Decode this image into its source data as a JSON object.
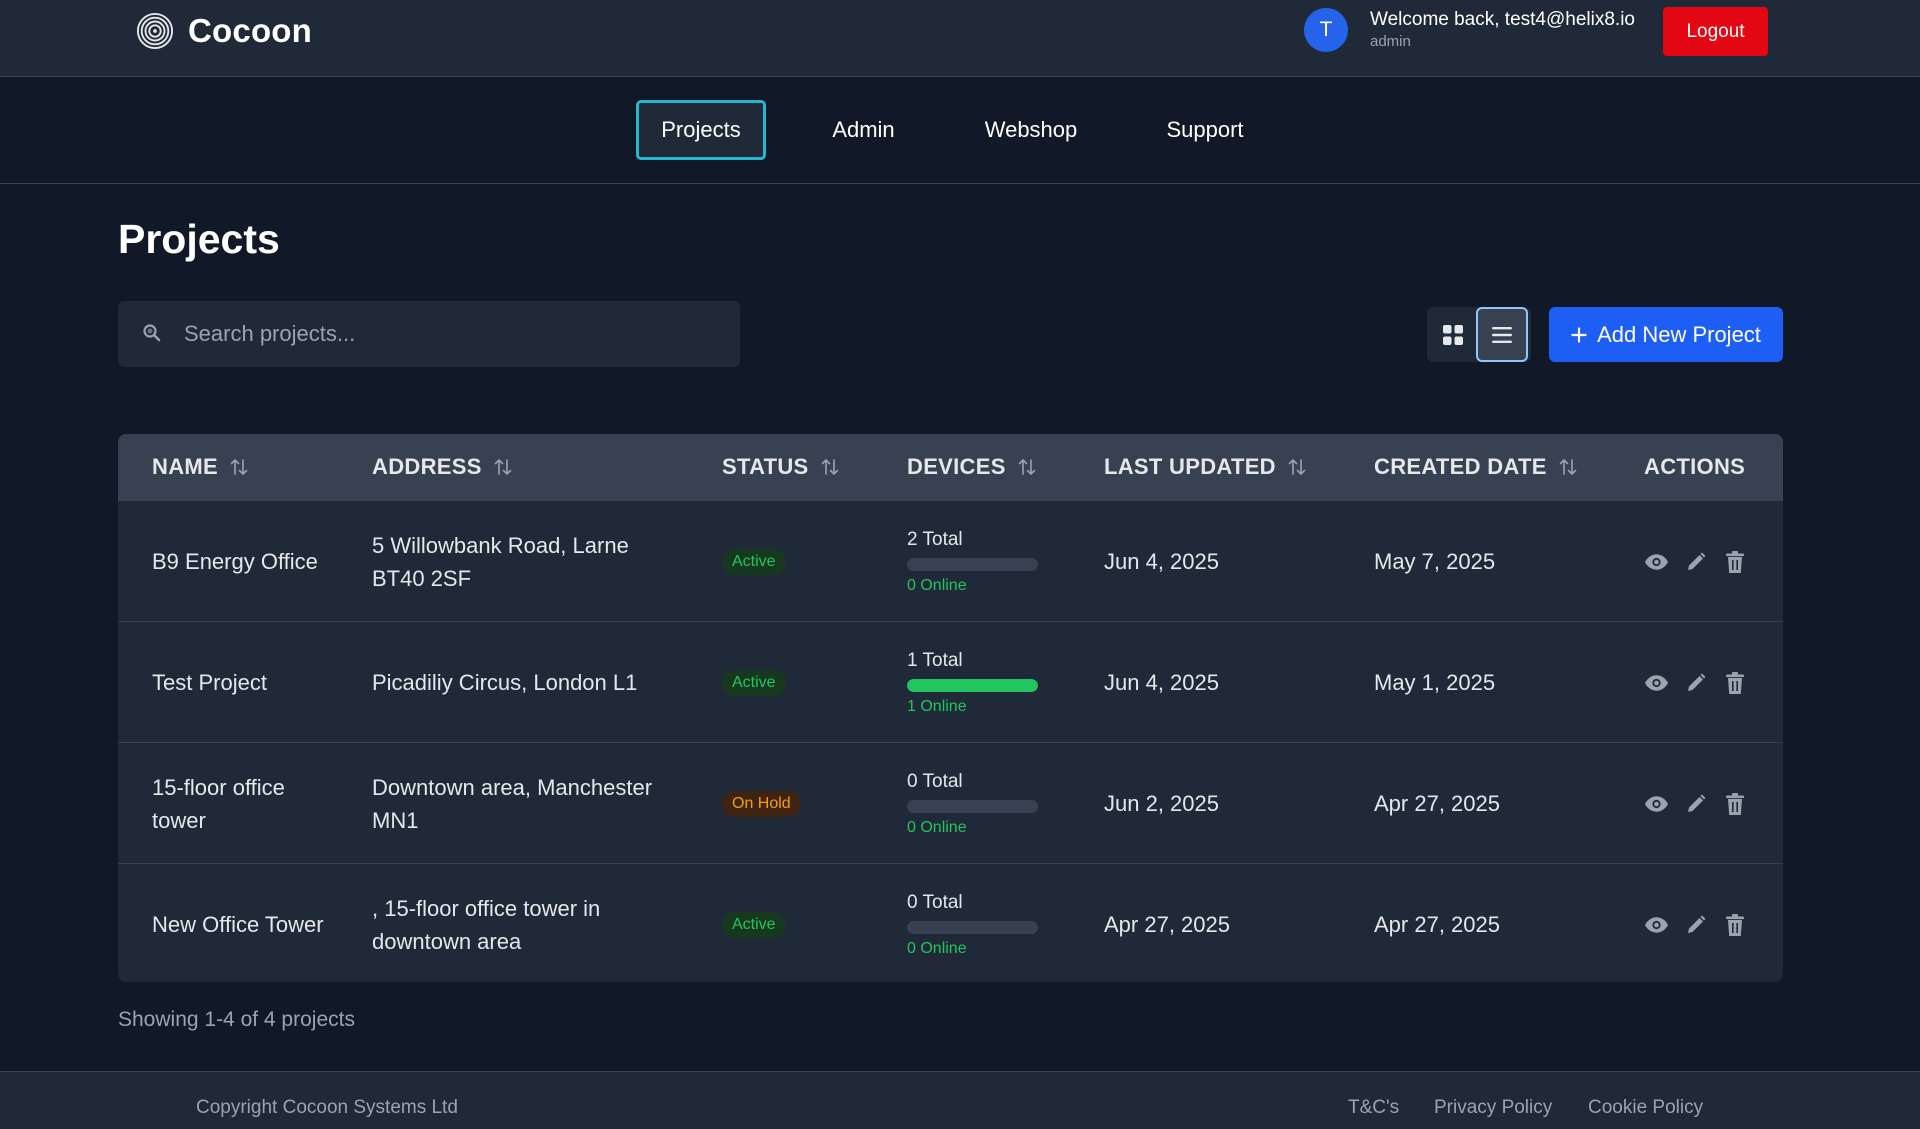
{
  "header": {
    "brand": "Cocoon",
    "avatar_initial": "T",
    "welcome": "Welcome back, test4@helix8.io",
    "role": "admin",
    "logout_label": "Logout",
    "logout_color": "#e30613"
  },
  "nav": {
    "items": [
      {
        "label": "Projects",
        "active": true
      },
      {
        "label": "Admin",
        "active": false
      },
      {
        "label": "Webshop",
        "active": false
      },
      {
        "label": "Support",
        "active": false
      }
    ],
    "active_border_color": "#22b8cf"
  },
  "page": {
    "title": "Projects",
    "search_placeholder": "Search projects...",
    "add_button_label": "Add New Project",
    "add_button_icon": "plus-icon",
    "view_modes": [
      "grid-view-icon",
      "list-view-icon"
    ],
    "selected_view": "list",
    "accent_color": "#1d5ef5"
  },
  "table": {
    "columns": [
      {
        "label": "NAME",
        "sortable": true
      },
      {
        "label": "ADDRESS",
        "sortable": true
      },
      {
        "label": "STATUS",
        "sortable": true
      },
      {
        "label": "DEVICES",
        "sortable": true
      },
      {
        "label": "LAST UPDATED",
        "sortable": true
      },
      {
        "label": "CREATED DATE",
        "sortable": true
      },
      {
        "label": "ACTIONS",
        "sortable": false
      }
    ],
    "rows": [
      {
        "name": "B9 Energy Office",
        "address": "5 Willowbank Road, Larne BT40 2SF",
        "status": "Active",
        "devices_total": "2 Total",
        "devices_online": "0 Online",
        "online_fraction": 0,
        "last_updated": "Jun 4, 2025",
        "created": "May 7, 2025"
      },
      {
        "name": "Test Project",
        "address": "Picadiliy Circus, London L1",
        "status": "Active",
        "devices_total": "1 Total",
        "devices_online": "1 Online",
        "online_fraction": 1,
        "last_updated": "Jun 4, 2025",
        "created": "May 1, 2025"
      },
      {
        "name": "15-floor office tower",
        "address": "Downtown area, Manchester MN1",
        "status": "On Hold",
        "devices_total": "0 Total",
        "devices_online": "0 Online",
        "online_fraction": 0,
        "last_updated": "Jun 2, 2025",
        "created": "Apr 27, 2025"
      },
      {
        "name": "New Office Tower",
        "address": ", 15-floor office tower in downtown area",
        "status": "Active",
        "devices_total": "0 Total",
        "devices_online": "0 Online",
        "online_fraction": 0,
        "last_updated": "Apr 27, 2025",
        "created": "Apr 27, 2025"
      }
    ],
    "row_action_icons": [
      "eye-icon",
      "pencil-icon",
      "trash-icon"
    ],
    "status_colors": {
      "Active": "#22c55e",
      "On Hold": "#f59e0b"
    }
  },
  "summary": "Showing 1-4 of 4 projects",
  "footer": {
    "copyright": "Copyright Cocoon Systems Ltd",
    "links": [
      "T&C's",
      "Privacy Policy",
      "Cookie Policy"
    ]
  }
}
